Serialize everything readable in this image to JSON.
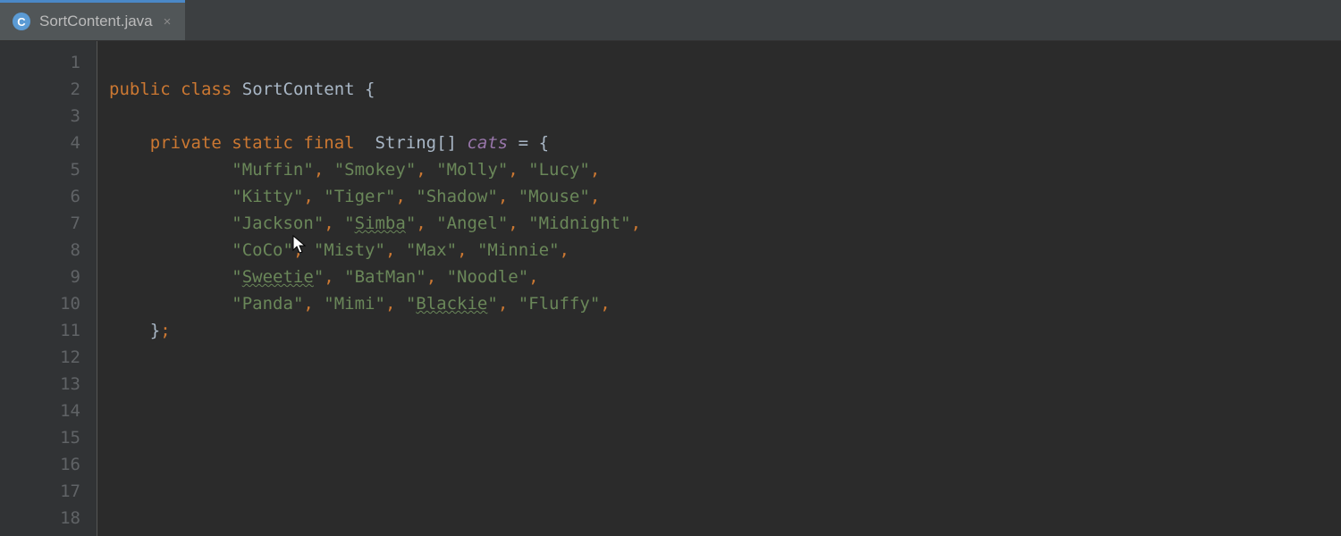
{
  "tab": {
    "icon_letter": "C",
    "filename": "SortContent.java",
    "close_glyph": "×"
  },
  "gutter": {
    "lines": [
      "1",
      "2",
      "3",
      "4",
      "5",
      "6",
      "7",
      "8",
      "9",
      "10",
      "11",
      "12",
      "13",
      "14",
      "15",
      "16",
      "17",
      "18"
    ]
  },
  "code": {
    "line1": "",
    "line2": {
      "kw1": "public",
      "sp1": " ",
      "kw2": "class",
      "sp2": " ",
      "cls": "SortContent",
      "sp3": " ",
      "brace": "{"
    },
    "line3": "",
    "line4": {
      "indent": "    ",
      "kw1": "private",
      "sp1": " ",
      "kw2": "static",
      "sp2": " ",
      "kw3": "final",
      "sp3": "  ",
      "type": "String[]",
      "sp4": " ",
      "field": "cats",
      "sp5": " ",
      "eq": "=",
      "sp6": " ",
      "brace": "{"
    },
    "line5": {
      "indent": "            ",
      "q1": "\"",
      "v1": "Muffin",
      "q2": "\"",
      "c1": ", ",
      "q3": "\"",
      "v2": "Smokey",
      "q4": "\"",
      "c2": ", ",
      "q5": "\"",
      "v3": "Molly",
      "q6": "\"",
      "c3": ", ",
      "q7": "\"",
      "v4": "Lucy",
      "q8": "\"",
      "c4": ","
    },
    "line6": {
      "indent": "            ",
      "q1": "\"",
      "v1": "Kitty",
      "q2": "\"",
      "c1": ", ",
      "q3": "\"",
      "v2": "Tiger",
      "q4": "\"",
      "c2": ", ",
      "q5": "\"",
      "v3": "Shadow",
      "q6": "\"",
      "c3": ", ",
      "q7": "\"",
      "v4": "Mouse",
      "q8": "\"",
      "c4": ","
    },
    "line7": {
      "indent": "            ",
      "q1": "\"",
      "v1": "Jackson",
      "q2": "\"",
      "c1": ", ",
      "q3": "\"",
      "v2": "Simba",
      "q4": "\"",
      "c2": ", ",
      "q5": "\"",
      "v3": "Angel",
      "q6": "\"",
      "c3": ", ",
      "q7": "\"",
      "v4": "Midnight",
      "q8": "\"",
      "c4": ","
    },
    "line8": {
      "indent": "            ",
      "q1": "\"",
      "v1": "CoCo",
      "q2": "\"",
      "c1": ", ",
      "q3": "\"",
      "v2": "Misty",
      "q4": "\"",
      "c2": ", ",
      "q5": "\"",
      "v3": "Max",
      "q6": "\"",
      "c3": ", ",
      "q7": "\"",
      "v4": "Minnie",
      "q8": "\"",
      "c4": ","
    },
    "line9": {
      "indent": "            ",
      "q1": "\"",
      "v1": "Sweetie",
      "q2": "\"",
      "c1": ", ",
      "q3": "\"",
      "v2": "BatMan",
      "q4": "\"",
      "c2": ", ",
      "q5": "\"",
      "v3": "Noodle",
      "q6": "\"",
      "c3": ","
    },
    "line10": {
      "indent": "            ",
      "q1": "\"",
      "v1": "Panda",
      "q2": "\"",
      "c1": ", ",
      "q3": "\"",
      "v2": "Mimi",
      "q4": "\"",
      "c2": ", ",
      "q5": "\"",
      "v3": "Blackie",
      "q6": "\"",
      "c3": ", ",
      "q7": "\"",
      "v4": "Fluffy",
      "q8": "\"",
      "c4": ","
    },
    "line11": {
      "indent": "    ",
      "brace": "}",
      "semi": ";"
    }
  }
}
